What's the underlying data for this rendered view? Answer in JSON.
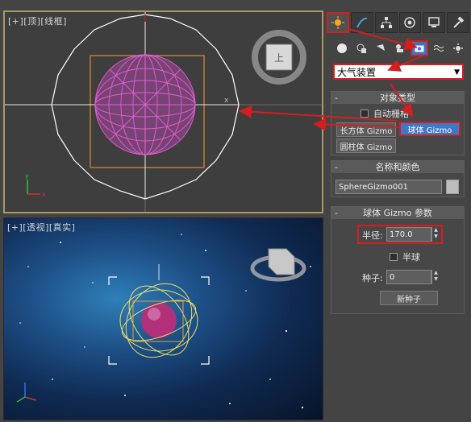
{
  "viewports": {
    "top_label": "[+][顶][线框]",
    "persp_label": "[+][透视][真实]"
  },
  "panel": {
    "tabs": [
      "create-tab",
      "modify-tab",
      "hierarchy-tab",
      "motion-tab",
      "display-tab",
      "utilities-tab"
    ],
    "category_dropdown": "大气装置",
    "object_type": {
      "title": "对象类型",
      "autogrid_label": "自动栅格",
      "buttons": [
        "长方体 Gizmo",
        "球体 Gizmo",
        "圆柱体 Gizmo"
      ]
    },
    "name_color": {
      "title": "名称和颜色",
      "name_value": "SphereGizmo001"
    },
    "params": {
      "title": "球体 Gizmo 参数",
      "radius_label": "半径:",
      "radius_value": "170.0",
      "hemisphere_label": "半球",
      "seed_label": "种子:",
      "seed_value": "0",
      "new_seed_label": "新种子"
    }
  },
  "colors": {
    "accent_red": "#d21f1f",
    "selection_blue": "#3e78c8",
    "gizmo_pink": "#e060d0",
    "viewport_border": "#a89a66"
  }
}
